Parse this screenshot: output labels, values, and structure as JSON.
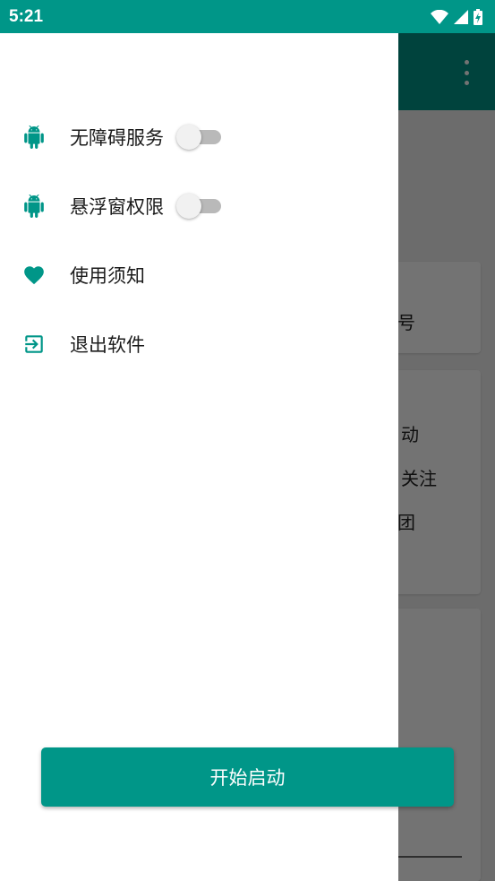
{
  "status_bar": {
    "time": "5:21",
    "icons": [
      "wifi-icon",
      "signal-icon",
      "battery-charging-icon"
    ]
  },
  "background": {
    "texts": [
      "号",
      "动",
      "关注",
      "团"
    ]
  },
  "drawer": {
    "items": [
      {
        "icon": "android-icon",
        "label": "无障碍服务",
        "has_switch": true,
        "switch_on": false
      },
      {
        "icon": "android-icon",
        "label": "悬浮窗权限",
        "has_switch": true,
        "switch_on": false
      },
      {
        "icon": "heart-icon",
        "label": "使用须知"
      },
      {
        "icon": "exit-icon",
        "label": "退出软件"
      }
    ]
  },
  "start_button": {
    "label": "开始启动"
  },
  "colors": {
    "primary": "#009688",
    "primary_dark": "#00796b",
    "scrim": "rgba(0,0,0,0.55)"
  }
}
